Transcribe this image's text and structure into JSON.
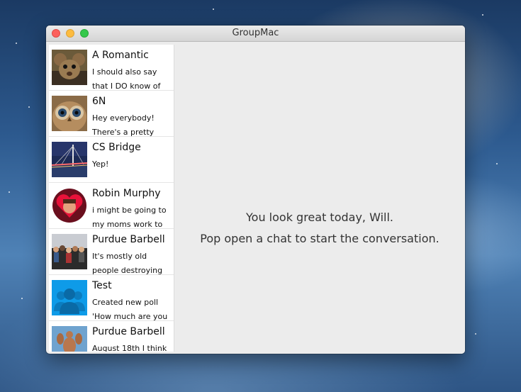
{
  "window": {
    "title": "GroupMac"
  },
  "chats": [
    {
      "name": "A Romantic",
      "preview": "I should also say that I DO know of non-",
      "avatar_icon": "rat-photo-avatar"
    },
    {
      "name": "6N",
      "preview": "Hey everybody! There's a pretty",
      "avatar_icon": "owl-photo-avatar"
    },
    {
      "name": "CS Bridge",
      "preview": "Yep!",
      "avatar_icon": "bridge-photo-avatar"
    },
    {
      "name": "Robin Murphy",
      "preview": "i might be going to my moms work to",
      "avatar_icon": "heart-photo-avatar"
    },
    {
      "name": "Purdue Barbell",
      "preview": "It's mostly old people destroying",
      "avatar_icon": "crowd-photo-avatar"
    },
    {
      "name": "Test",
      "preview": "Created new poll 'How much are you",
      "avatar_icon": "group-default-avatar"
    },
    {
      "name": "Purdue Barbell",
      "preview": "August 18th I think",
      "avatar_icon": "bodybuilder-photo-avatar"
    }
  ],
  "main": {
    "line1": "You look great today, Will.",
    "line2": "Pop open a chat to start the conversation."
  }
}
